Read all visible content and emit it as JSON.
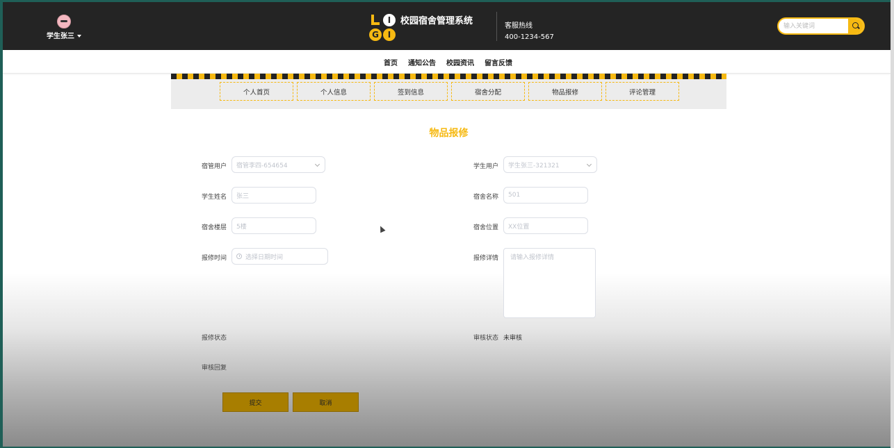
{
  "header": {
    "user_name": "学生张三",
    "site_title": "校园宿舍管理系统",
    "hotline_label": "客服热线",
    "hotline_number": "400-1234-567",
    "search_placeholder": "输入关键词"
  },
  "main_nav": [
    "首页",
    "通知公告",
    "校园资讯",
    "留言反馈"
  ],
  "sub_nav": [
    "个人首页",
    "个人信息",
    "签到信息",
    "宿舍分配",
    "物品报修",
    "评论管理"
  ],
  "page_title": "物品报修",
  "form": {
    "dorm_manager_label": "宿管用户",
    "dorm_manager_value": "宿管李四-654654",
    "student_user_label": "学生用户",
    "student_user_value": "学生张三-321321",
    "student_name_label": "学生姓名",
    "student_name_value": "张三",
    "dorm_name_label": "宿舍名称",
    "dorm_name_value": "501",
    "dorm_floor_label": "宿舍楼层",
    "dorm_floor_value": "5楼",
    "dorm_location_label": "宿舍位置",
    "dorm_location_value": "XX位置",
    "repair_time_label": "报修时间",
    "repair_time_placeholder": "选择日期时间",
    "repair_detail_label": "报修详情",
    "repair_detail_placeholder": "请输入报修详情",
    "repair_status_label": "报修状态",
    "audit_status_label": "审核状态",
    "audit_status_value": "未审核",
    "audit_reply_label": "审核回复"
  },
  "buttons": {
    "submit": "提交",
    "cancel": "取消"
  },
  "colors": {
    "accent": "#f6b912",
    "header_bg": "#242424",
    "button_bg": "#a87e00"
  }
}
